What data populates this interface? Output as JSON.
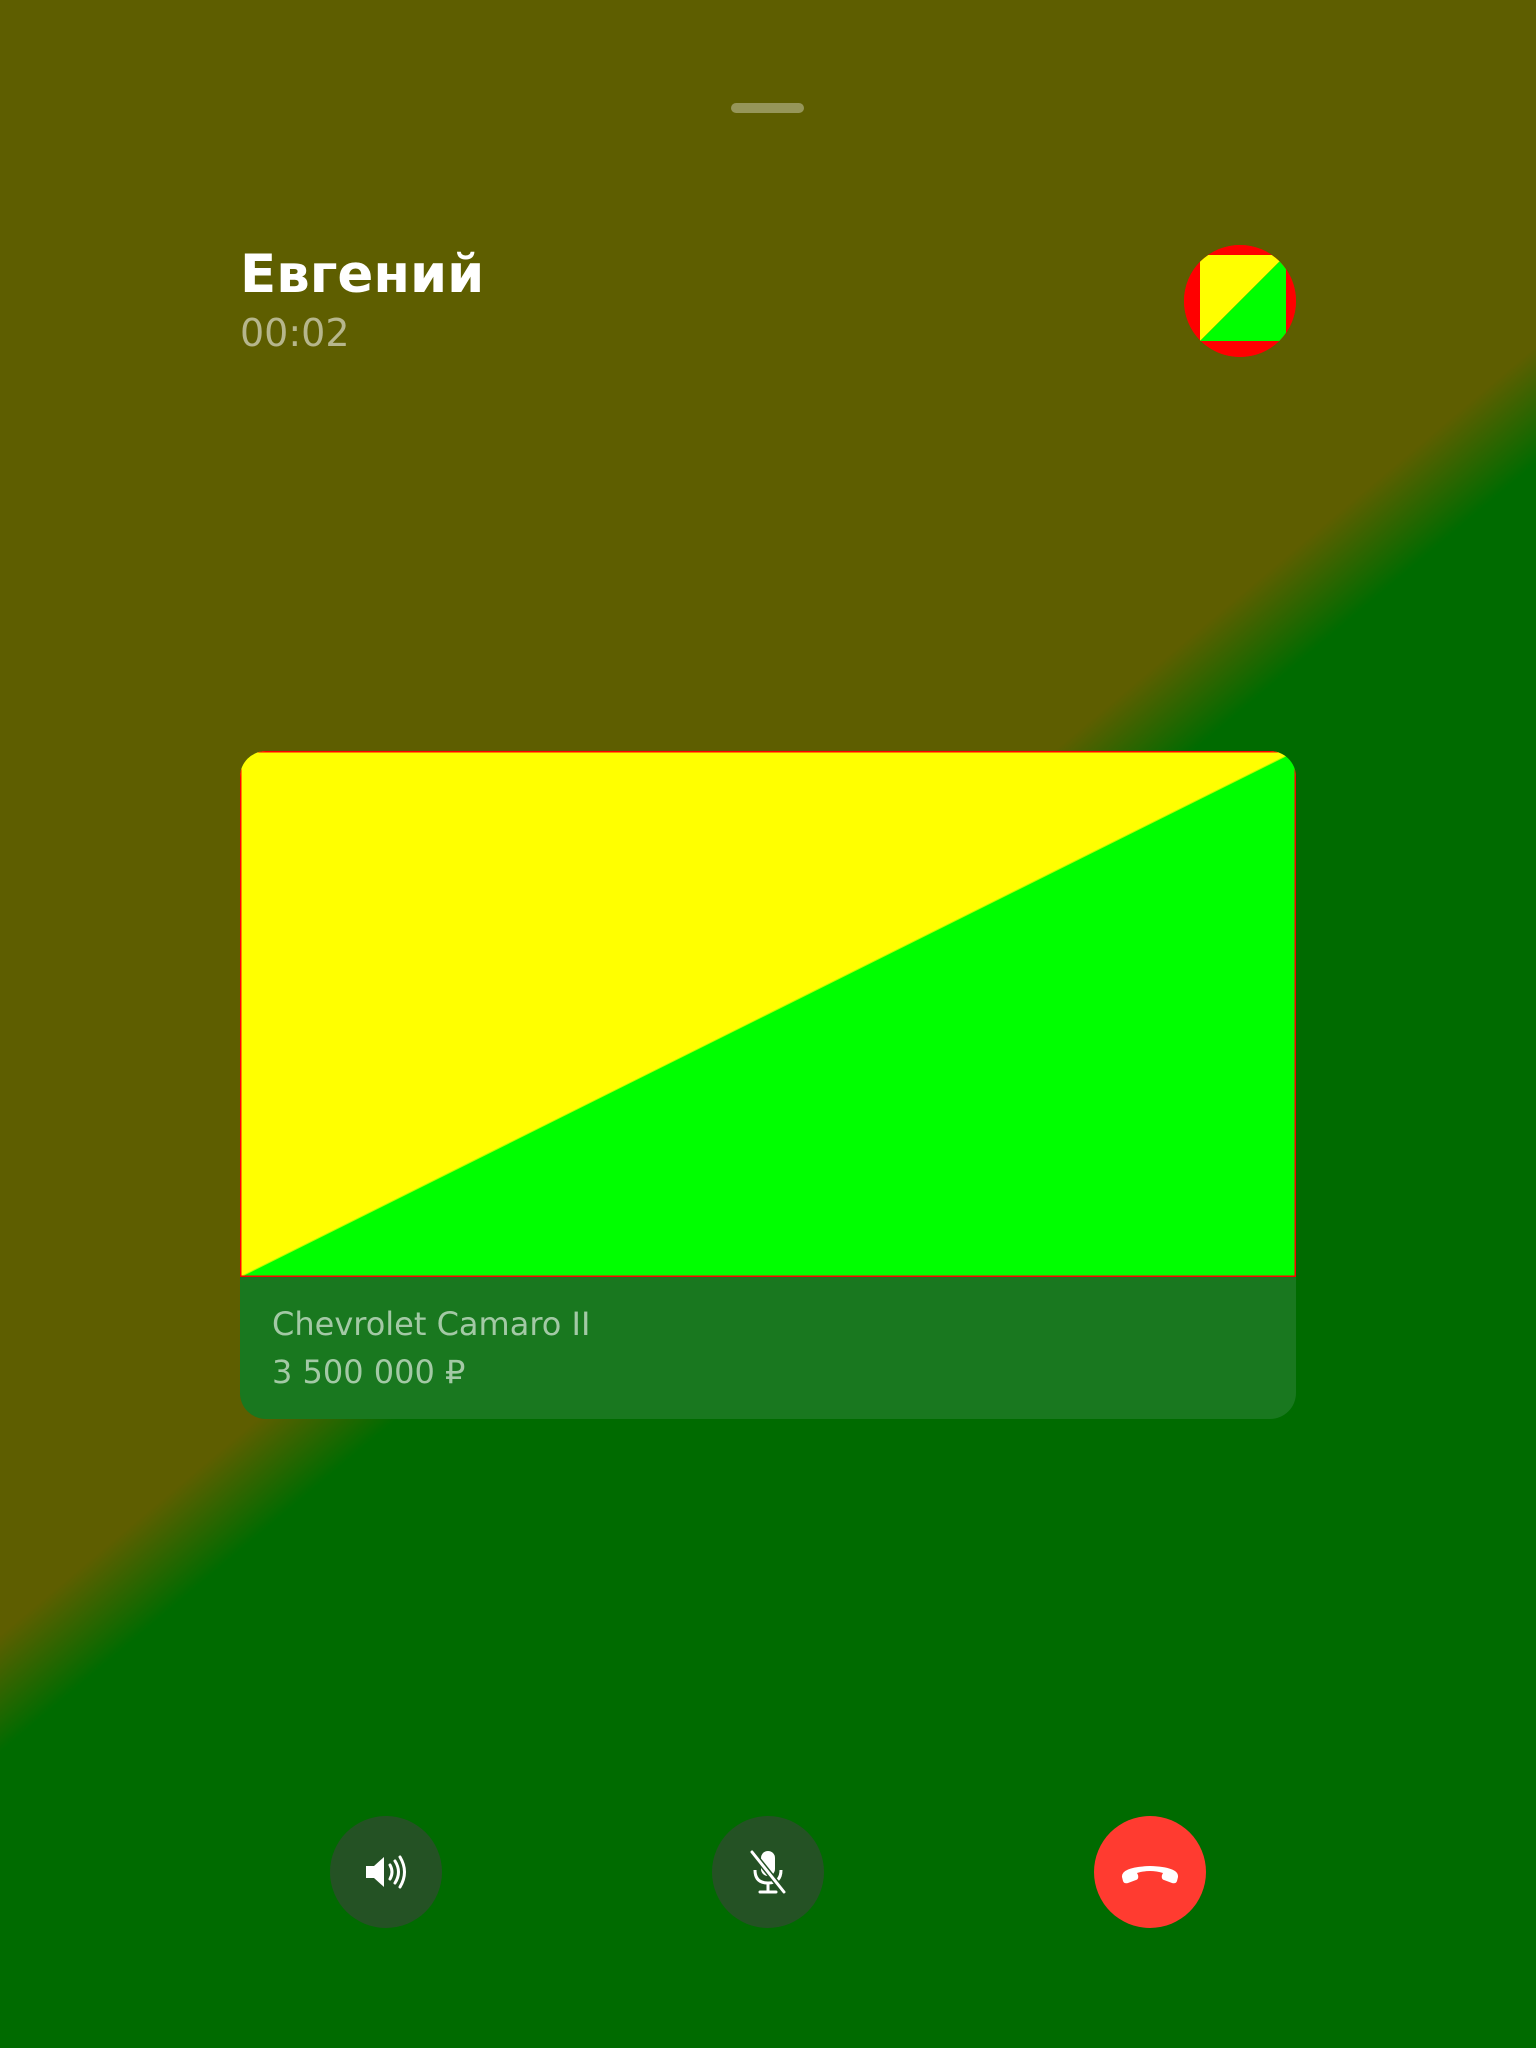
{
  "call": {
    "caller_name": "Евгений",
    "duration": "00:02"
  },
  "listing": {
    "title": "Chevrolet Camaro II",
    "price": "3 500 000 ₽"
  },
  "controls": [
    {
      "name": "speaker",
      "icon": "speaker-icon"
    },
    {
      "name": "mute",
      "icon": "mic-off-icon"
    },
    {
      "name": "end-call",
      "icon": "phone-hangup-icon"
    }
  ],
  "colors": {
    "background_top": "#5e5e00",
    "background_bottom": "#006b00",
    "end_call": "#ff3b30",
    "control_bg": "#245224",
    "image_yellow": "#ffff00",
    "image_green": "#00ff00",
    "image_border": "#ff0000"
  }
}
